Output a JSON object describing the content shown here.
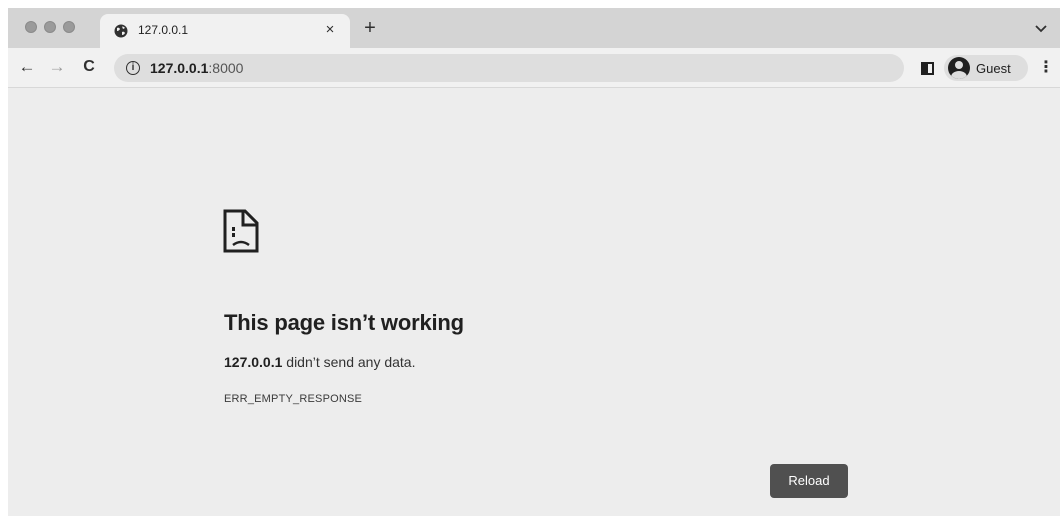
{
  "tab": {
    "title": "127.0.0.1",
    "close_glyph": "×",
    "new_tab_glyph": "+"
  },
  "toolbar": {
    "back_glyph": "←",
    "forward_glyph": "→",
    "reload_glyph": "C",
    "info_glyph": "i",
    "url_host": "127.0.0.1",
    "url_port": ":8000",
    "profile_label": "Guest",
    "menu_glyph": "⋮"
  },
  "error": {
    "title": "This page isn’t working",
    "host": "127.0.0.1",
    "message": " didn’t send any data.",
    "code": "ERR_EMPTY_RESPONSE",
    "reload_label": "Reload"
  },
  "icons": {
    "tab_favicon": "globe-icon",
    "error_icon": "sad-page-icon",
    "profile": "avatar-icon",
    "side_panel": "side-panel-icon"
  },
  "colors": {
    "page_background": "#ededed",
    "reload_button": "#505050"
  }
}
